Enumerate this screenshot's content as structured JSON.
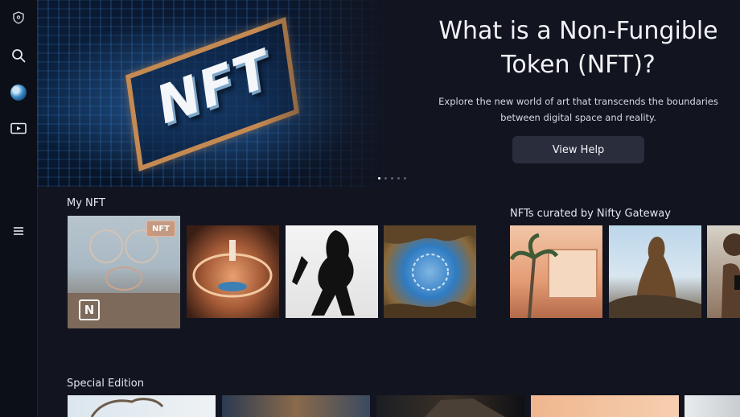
{
  "sidebar": {
    "items": [
      {
        "name": "shield-icon",
        "glyph": "⛨"
      },
      {
        "name": "search-icon",
        "glyph": "⌕"
      },
      {
        "name": "avatar-icon",
        "glyph": ""
      },
      {
        "name": "media-icon",
        "glyph": "▶"
      },
      {
        "name": "menu-icon",
        "glyph": "☰"
      }
    ]
  },
  "hero": {
    "art_text": "NFT",
    "title": "What is a Non-Fungible Token (NFT)?",
    "description": "Explore the new world of art that transcends the boundaries between digital space and reality.",
    "button_label": "View Help",
    "pager": {
      "count": 5,
      "active": 0
    }
  },
  "my_nft": {
    "title": "My NFT",
    "badge": "NFT",
    "logo": "N"
  },
  "curated": {
    "title": "NFTs curated by Nifty Gateway"
  },
  "special": {
    "title": "Special Edition"
  },
  "colors": {
    "background": "#12141f",
    "sidebar": "#0d0f18",
    "button": "#2a2d3c",
    "frame": "#c48a52"
  }
}
